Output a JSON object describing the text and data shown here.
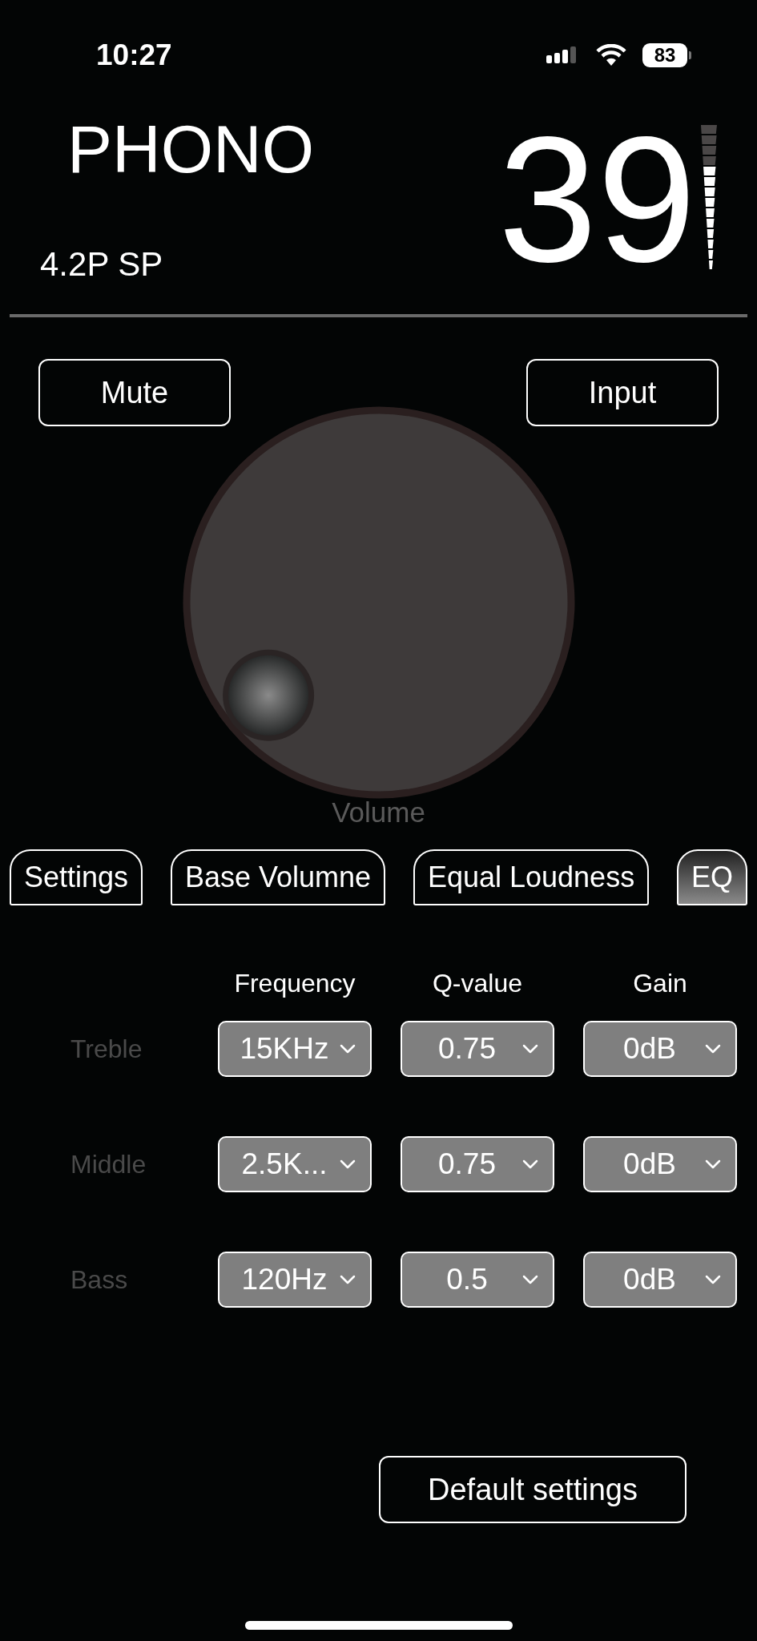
{
  "status_bar": {
    "time": "10:27",
    "battery": "83"
  },
  "header": {
    "source": "PHONO",
    "format": "4.2P SP",
    "volume": "39",
    "meter": {
      "level": 0.7
    }
  },
  "buttons": [
    {
      "label": "Mute"
    },
    {
      "label": "Input"
    }
  ],
  "knob": {
    "label": "Volume"
  },
  "tabs": [
    {
      "label": "Settings",
      "selected": false
    },
    {
      "label": "Base Volumne",
      "selected": false
    },
    {
      "label": "Equal Loudness",
      "selected": false
    },
    {
      "label": "EQ",
      "selected": true
    }
  ],
  "eq": {
    "columns": [
      "Frequency",
      "Q-value",
      "Gain"
    ],
    "rows": [
      {
        "label": "Treble",
        "values": [
          "15KHz",
          "0.75",
          "0dB"
        ]
      },
      {
        "label": "Middle",
        "values": [
          "2.5K...",
          "0.75",
          "0dB"
        ]
      },
      {
        "label": "Bass",
        "values": [
          "120Hz",
          "0.5",
          "0dB"
        ]
      }
    ]
  },
  "default_button": {
    "label": "Default settings"
  }
}
